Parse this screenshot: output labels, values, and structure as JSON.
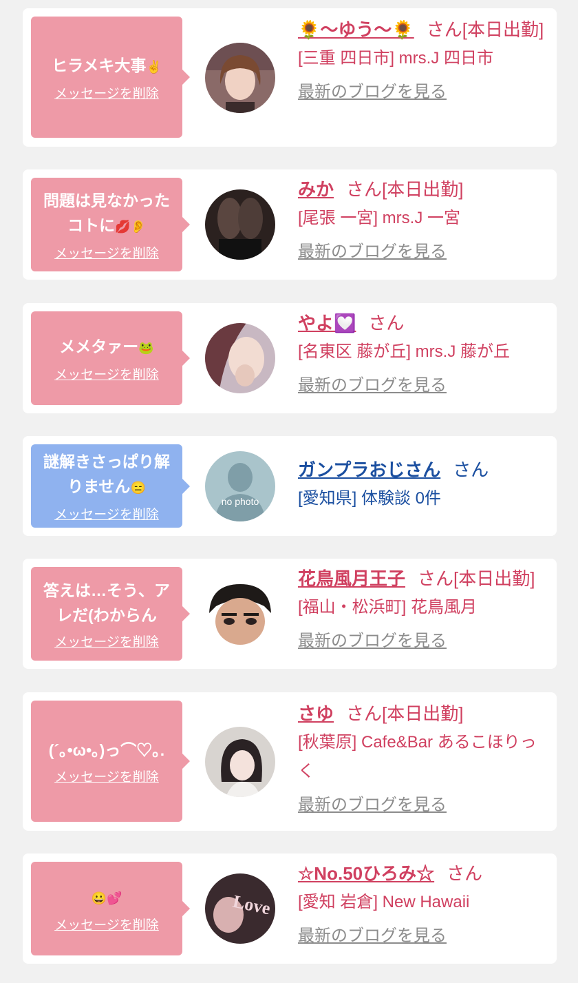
{
  "delete_label": "メッセージを削除",
  "blog_label": "最新のブログを見る",
  "colors": {
    "pink_bubble": "#ee9aa7",
    "blue_bubble": "#8fb2ef",
    "pink_text": "#d04060",
    "blue_text": "#1b4fa0",
    "gray_link": "#8c8c8c"
  },
  "entries": [
    {
      "message": "ヒラメキ大事",
      "message_emoji": "✌",
      "name": "🌻〜ゆう〜🌻",
      "suffix": "さん[本日出勤]",
      "location": "[三重 四日市] mrs.J 四日市",
      "avatar_icon": "woman-photo-avatar"
    },
    {
      "message": "問題は見なかったコトに",
      "message_emoji": "💋👂",
      "name": "みか",
      "suffix": "さん[本日出勤]",
      "location": "[尾張 一宮] mrs.J 一宮",
      "avatar_icon": "legs-photo-avatar"
    },
    {
      "message": "メメタァー",
      "message_emoji": "🐸",
      "name": "やよ💟",
      "suffix": "さん",
      "location": "[名東区 藤が丘] mrs.J 藤が丘",
      "avatar_icon": "woman-photo-avatar"
    },
    {
      "message": "謎解きさっぱり解りません",
      "message_emoji": "😑",
      "name": "ガンプラおじさん",
      "suffix": "さん",
      "location": "[愛知県] 体験談 0件",
      "avatar_icon": "no-photo-avatar",
      "avatar_text": "no photo"
    },
    {
      "message": "答えは…そう、アレだ(わからん",
      "message_emoji": "",
      "name": "花鳥風月王子",
      "suffix": "さん[本日出勤]",
      "location": "[福山・松浜町] 花鳥風月",
      "avatar_icon": "man-face-avatar"
    },
    {
      "message": "(´｡•ω•｡)っ⌒♡｡.",
      "message_emoji": "",
      "name": "さゆ",
      "suffix": "さん[本日出勤]",
      "location": "[秋葉原] Cafe&Bar あるこほりっく",
      "avatar_icon": "woman-photo-avatar"
    },
    {
      "message": "",
      "message_emoji": "😀💕",
      "name": "☆No.50ひろみ☆",
      "suffix": "さん",
      "location": "[愛知 岩倉] New Hawaii",
      "avatar_icon": "love-photo-avatar",
      "avatar_text": "Love"
    }
  ]
}
